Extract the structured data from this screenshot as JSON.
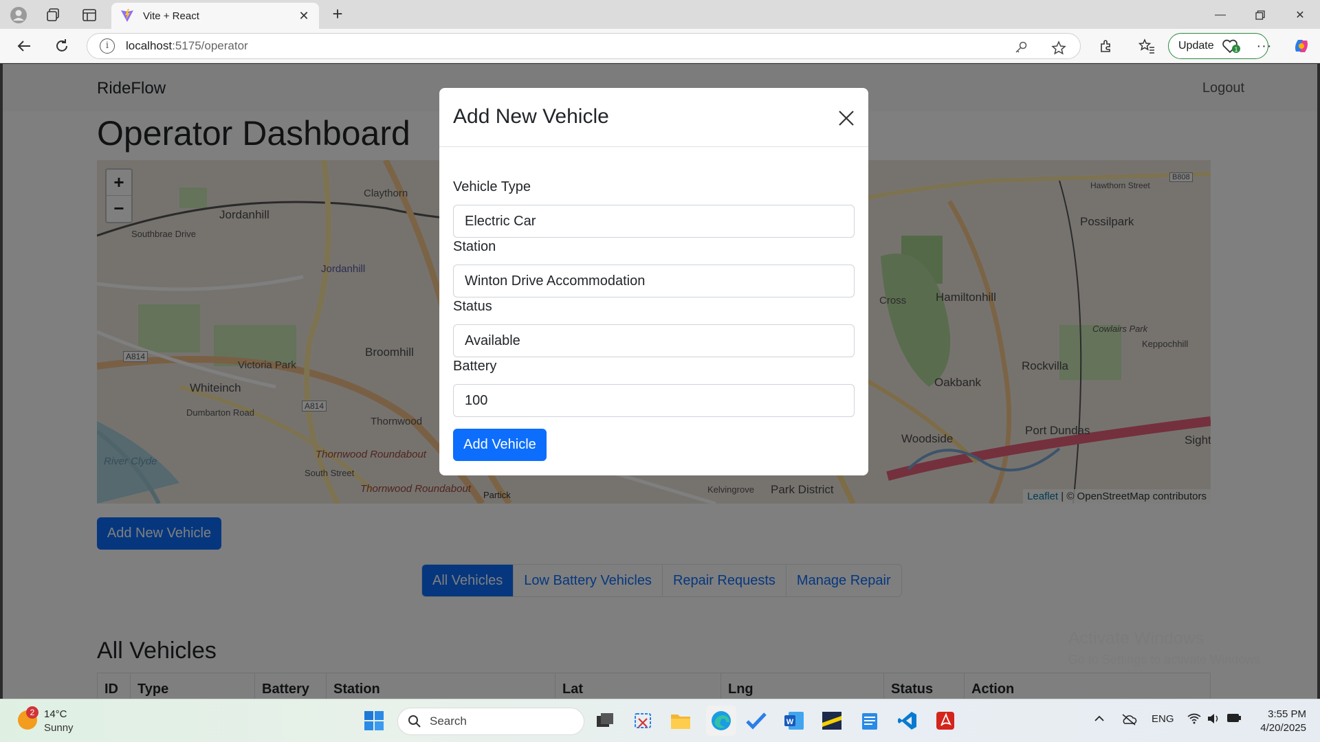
{
  "browser": {
    "tab_title": "Vite + React",
    "url_host": "localhost",
    "url_rest": ":5175/operator",
    "update_label": "Update"
  },
  "app": {
    "brand": "RideFlow",
    "logout_label": "Logout",
    "page_title": "Operator Dashboard",
    "add_vehicle_button": "Add New Vehicle"
  },
  "map": {
    "zoom_in": "+",
    "zoom_out": "−",
    "attribution_link": "Leaflet",
    "attribution_text": " | © OpenStreetMap contributors",
    "labels": [
      "Jordanhill",
      "Claythorn",
      "Jordanhill",
      "Broomhill",
      "Whiteinch",
      "Victoria Park",
      "Thornwood",
      "Thornwood Roundabout",
      "Thornwood Roundabout",
      "A814",
      "A814",
      "South Street",
      "River Clyde",
      "Southbrae Drive",
      "Dumbarton Road",
      "Partick",
      "Kelvingrove",
      "Park District",
      "Possilpark",
      "Hamiltonhill",
      "Rockvilla",
      "Oakbank",
      "Port Dundas",
      "Woodside",
      "Keppochhill",
      "Cowlairs Park",
      "Hawthorn Street",
      "B808",
      "Sighthill",
      "Cross"
    ]
  },
  "tabs": [
    {
      "label": "All Vehicles",
      "active": true
    },
    {
      "label": "Low Battery Vehicles",
      "active": false
    },
    {
      "label": "Repair Requests",
      "active": false
    },
    {
      "label": "Manage Repair",
      "active": false
    }
  ],
  "section_title": "All Vehicles",
  "table": {
    "headers": [
      "ID",
      "Type",
      "Battery",
      "Station",
      "Lat",
      "Lng",
      "Status",
      "Action"
    ]
  },
  "watermark": {
    "line1": "Activate Windows",
    "line2": "Go to Settings to activate Windows."
  },
  "modal": {
    "title": "Add New Vehicle",
    "fields": [
      {
        "label": "Vehicle Type",
        "value": "Electric Car"
      },
      {
        "label": "Station",
        "value": "Winton Drive Accommodation"
      },
      {
        "label": "Status",
        "value": "Available"
      },
      {
        "label": "Battery",
        "value": "100"
      }
    ],
    "submit_label": "Add Vehicle"
  },
  "taskbar": {
    "weather_badge": "2",
    "weather_temp": "14°C",
    "weather_desc": "Sunny",
    "search_placeholder": "Search",
    "language": "ENG",
    "time": "3:55 PM",
    "date": "4/20/2025"
  },
  "colors": {
    "primary": "#0d6efd",
    "backdrop": "rgba(0,0,0,0.5)"
  }
}
